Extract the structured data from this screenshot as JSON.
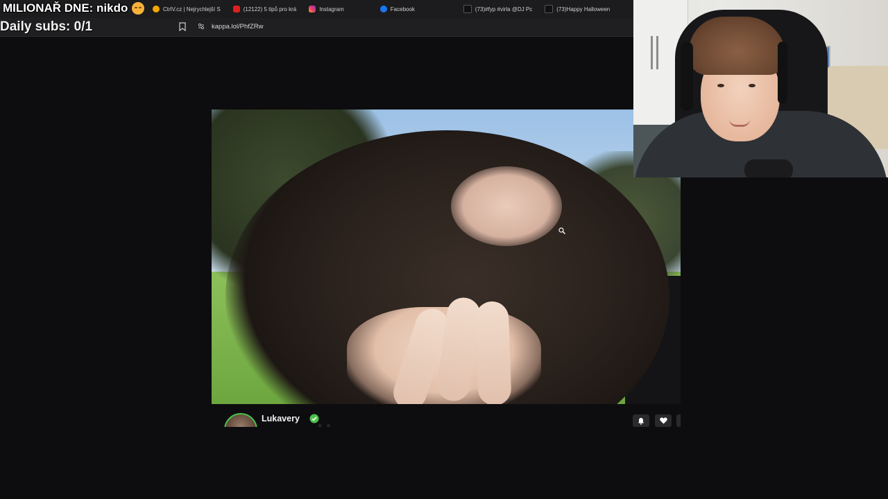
{
  "overlay": {
    "title": "MILIONAŘ DNE: nikdo",
    "daily_subs": "Daily subs: 0/1"
  },
  "bookmarks": [
    {
      "label": "CtrlV.cz | Nejrychlejší S",
      "icon": "ctrlv-icon"
    },
    {
      "label": "(12122) 5 tipů pro krá",
      "icon": "youtube-icon"
    },
    {
      "label": "Instagram",
      "icon": "instagram-icon"
    },
    {
      "label": "Facebook",
      "icon": "facebook-icon"
    },
    {
      "label": "(73)#fyp #virla @DJ Pc",
      "icon": "tiktok-icon"
    },
    {
      "label": "(73)Happy Halloween",
      "icon": "tiktok-icon"
    }
  ],
  "address_bar": {
    "url": "kappa.lol/PhfZRw"
  },
  "post": {
    "username": "Lukavery",
    "caption": "[...]"
  },
  "colors": {
    "page_bg": "#0d0d0f",
    "chrome_bg": "#1c1c1e",
    "verified_green": "#4cc04a"
  }
}
